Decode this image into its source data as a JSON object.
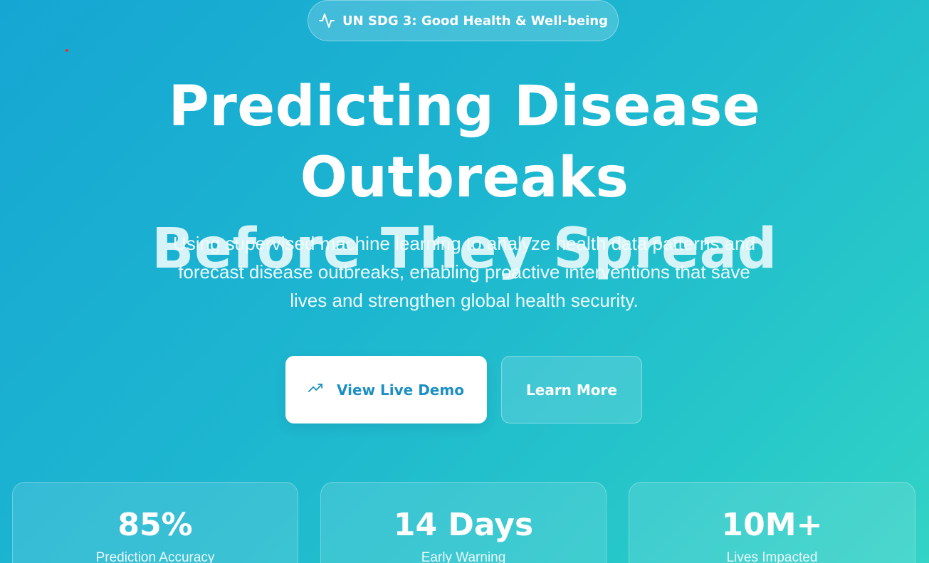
{
  "badge": {
    "icon": "activity-pulse-icon",
    "label": "UN SDG 3: Good Health & Well-being"
  },
  "hero": {
    "title_line1": "Predicting Disease Outbreaks",
    "title_line2": "Before They Spread",
    "subtitle_line1": "Using supervised machine learning to analyze health data patterns and",
    "subtitle_line2": "forecast disease outbreaks, enabling proactive interventions that save",
    "subtitle_line3": "lives and strengthen global health security."
  },
  "buttons": {
    "primary_label": "View Live Demo",
    "primary_icon": "trending-up-icon",
    "secondary_label": "Learn More"
  },
  "stats": [
    {
      "value": "85%",
      "label": "Prediction Accuracy"
    },
    {
      "value": "14 Days",
      "label": "Early Warning"
    },
    {
      "value": "10M+",
      "label": "Lives Impacted"
    }
  ],
  "colors": {
    "accent": "#1b8fc4",
    "gradient_start": "#16a6d3",
    "gradient_end": "#33d3c6"
  }
}
